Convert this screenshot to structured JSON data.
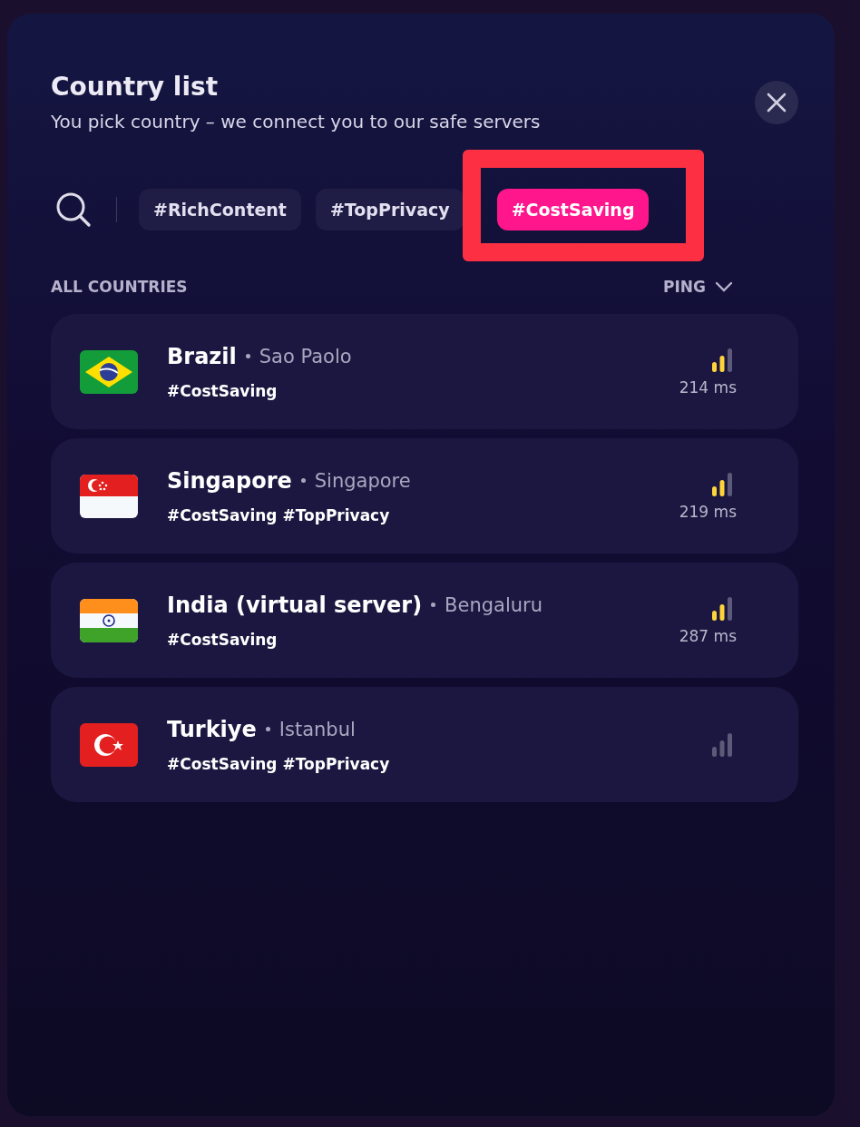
{
  "dialog": {
    "title": "Country list",
    "subtitle": "You pick country – we connect you to our safe servers"
  },
  "filters": [
    {
      "label": "#RichContent",
      "selected": false,
      "highlighted": false
    },
    {
      "label": "#TopPrivacy",
      "selected": false,
      "highlighted": false
    },
    {
      "label": "#CostSaving",
      "selected": true,
      "highlighted": true
    }
  ],
  "list_header": {
    "label": "ALL COUNTRIES",
    "sort": "PING"
  },
  "countries": [
    {
      "kind": "brazil",
      "name": "Brazil",
      "city": "Sao Paolo",
      "tags": "#CostSaving",
      "signal_on": true,
      "ping": "214 ms"
    },
    {
      "kind": "singapore",
      "name": "Singapore",
      "city": "Singapore",
      "tags": "#CostSaving #TopPrivacy",
      "signal_on": true,
      "ping": "219 ms"
    },
    {
      "kind": "india",
      "name": "India (virtual server)",
      "city": "Bengaluru",
      "tags": "#CostSaving",
      "signal_on": true,
      "ping": "287 ms"
    },
    {
      "kind": "turkey",
      "name": "Turkiye",
      "city": "Istanbul",
      "tags": "#CostSaving #TopPrivacy",
      "signal_on": false
    }
  ]
}
